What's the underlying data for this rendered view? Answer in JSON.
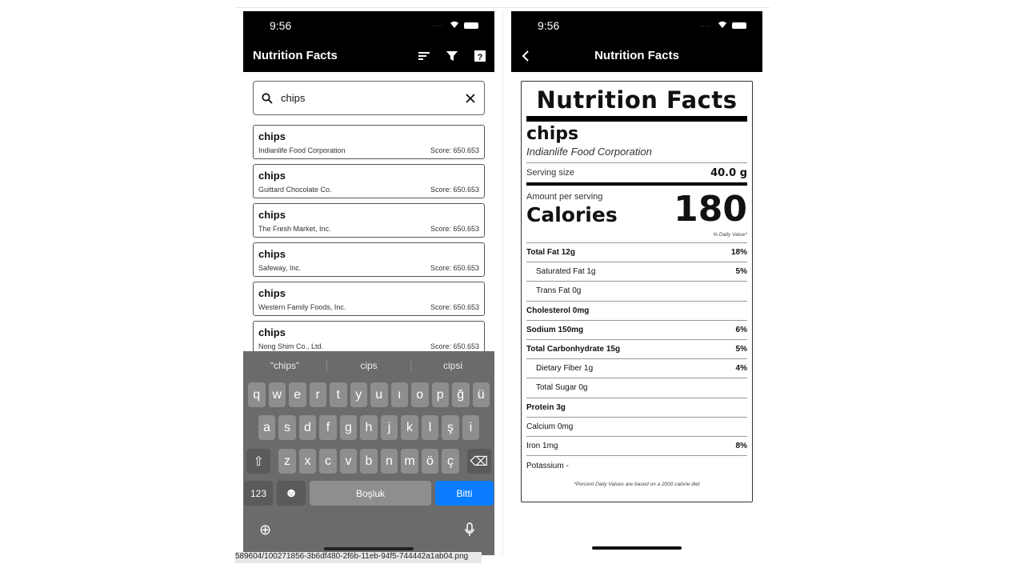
{
  "left": {
    "status_time": "9:56",
    "title": "Nutrition Facts",
    "icons": [
      "sort-icon",
      "filter-icon",
      "help-icon"
    ],
    "search": {
      "value": "chips"
    },
    "results": [
      {
        "name": "chips",
        "company": "Indianlife Food Corporation",
        "score": "Score: 650.653"
      },
      {
        "name": "chips",
        "company": "Guittard Chocolate Co.",
        "score": "Score: 650.653"
      },
      {
        "name": "chips",
        "company": "The Fresh Market, Inc.",
        "score": "Score: 650.653"
      },
      {
        "name": "chips",
        "company": "Safeway, Inc.",
        "score": "Score: 650.653"
      },
      {
        "name": "chips",
        "company": "Western Family Foods, Inc.",
        "score": "Score: 650.653"
      },
      {
        "name": "chips",
        "company": "Nong Shim Co., Ltd.",
        "score": "Score: 650.653"
      }
    ],
    "keyboard": {
      "suggestions": [
        "“chips”",
        "cips",
        "cipsi"
      ],
      "row1": [
        "q",
        "w",
        "e",
        "r",
        "t",
        "y",
        "u",
        "ı",
        "o",
        "p",
        "ğ",
        "ü"
      ],
      "row2": [
        "a",
        "s",
        "d",
        "f",
        "g",
        "h",
        "j",
        "k",
        "l",
        "ş",
        "i"
      ],
      "row3": [
        "z",
        "x",
        "c",
        "v",
        "b",
        "n",
        "m",
        "ö",
        "ç"
      ],
      "num": "123",
      "space": "Boşluk",
      "done": "Bitti",
      "done_color": "#0a7cff"
    }
  },
  "right": {
    "status_time": "9:56",
    "title": "Nutrition Facts",
    "label": {
      "heading": "Nutrition Facts",
      "food": "chips",
      "brand": "Indianlife Food Corporation",
      "serving_label": "Serving size",
      "serving_value": "40.0 g",
      "amount_label": "Amount per serving",
      "calories_label": "Calories",
      "calories": "180",
      "dv_header": "% Daily Value*",
      "rows": [
        {
          "name": "Total Fat 12g",
          "dv": "18%",
          "style": "b"
        },
        {
          "name": "Saturated Fat 1g",
          "dv": "5%",
          "style": "sub"
        },
        {
          "name": "Trans Fat 0g",
          "dv": "",
          "style": "sub"
        },
        {
          "name": "Cholesterol 0mg",
          "dv": "",
          "style": "b"
        },
        {
          "name": "Sodium 150mg",
          "dv": "6%",
          "style": "b"
        },
        {
          "name": "Total Carbonhydrate 15g",
          "dv": "5%",
          "style": "b"
        },
        {
          "name": "Dietary Fiber 1g",
          "dv": "4%",
          "style": "sub"
        },
        {
          "name": "Total Sugar 0g",
          "dv": "",
          "style": "sub"
        },
        {
          "name": "Protein 3g",
          "dv": "",
          "style": "b"
        },
        {
          "name": "Calcium 0mg",
          "dv": "",
          "style": "n"
        },
        {
          "name": "Iron 1mg",
          "dv": "8%",
          "style": "n"
        },
        {
          "name": "Potassium -",
          "dv": "",
          "style": "n"
        }
      ],
      "footnote": "*Percent Daily Values are based on a 2000 calorie diet"
    }
  },
  "path_text": "589604/100271856-3b6df480-2f6b-11eb-94f5-744442a1ab04.png"
}
